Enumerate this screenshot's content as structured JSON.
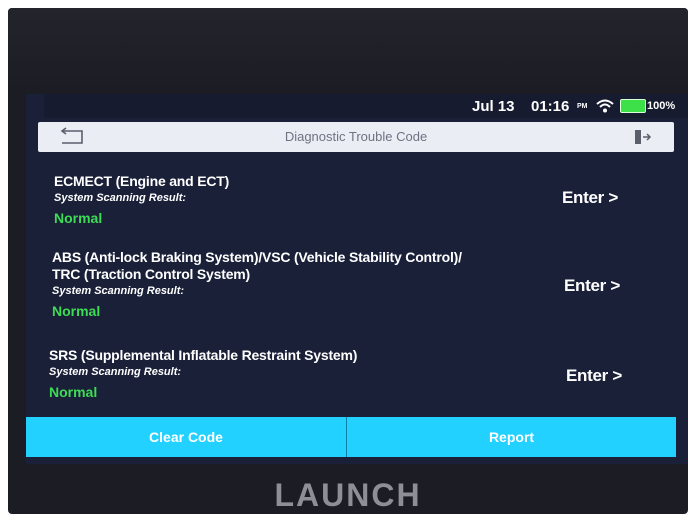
{
  "status_bar": {
    "date": "Jul 13",
    "time": "01:16",
    "ampm": "PM",
    "battery": "100%"
  },
  "header": {
    "title": "Diagnostic Trouble Code",
    "back_icon": "back-arrow-icon",
    "exit_icon": "exit-icon"
  },
  "systems": [
    {
      "name_lines": [
        "ECMECT (Engine and ECT)"
      ],
      "result_label": "System Scanning Result:",
      "result": "Normal",
      "enter_label": "Enter >"
    },
    {
      "name_lines": [
        "ABS (Anti-lock Braking System)/VSC (Vehicle Stability Control)/",
        "TRC (Traction Control System)"
      ],
      "result_label": "System Scanning Result:",
      "result": "Normal",
      "enter_label": "Enter >"
    },
    {
      "name_lines": [
        "SRS (Supplemental Inflatable Restraint System)"
      ],
      "result_label": "System Scanning Result:",
      "result": "Normal",
      "enter_label": "Enter >"
    }
  ],
  "actions": {
    "clear_code": "Clear Code",
    "report": "Report"
  },
  "brand": "LAUNCH",
  "colors": {
    "accent": "#22d1ff",
    "status_ok": "#3ddc54",
    "screen_bg": "#1a2038"
  }
}
